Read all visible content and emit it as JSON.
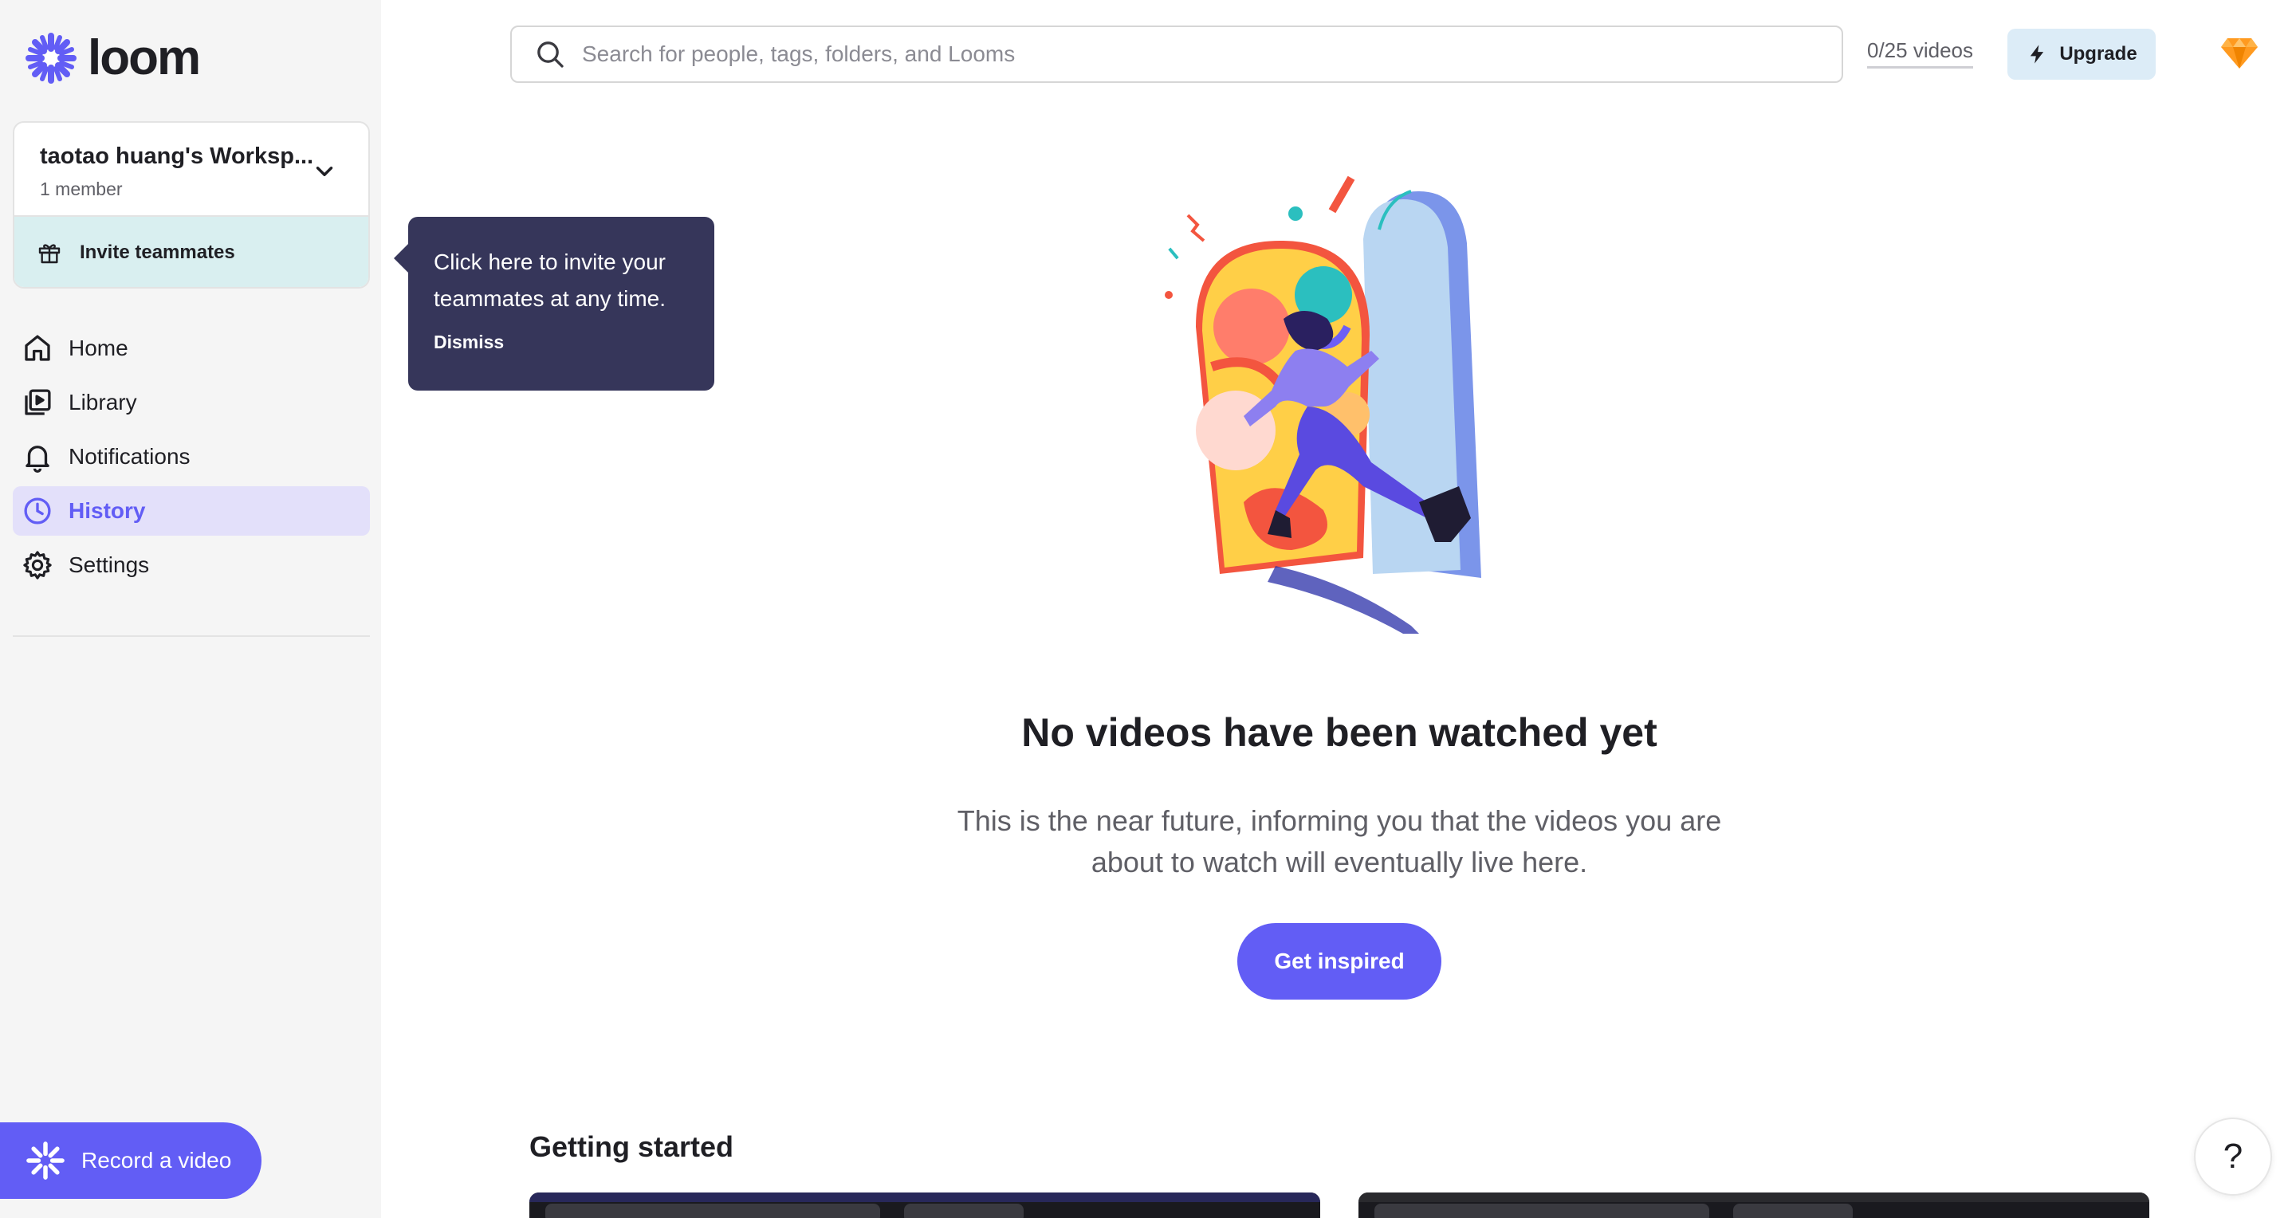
{
  "brand": {
    "name": "loom",
    "accent": "#625df5"
  },
  "workspace": {
    "name": "taotao huang's Worksp...",
    "members": "1 member",
    "invite_label": "Invite teammates"
  },
  "nav": {
    "items": [
      {
        "label": "Home",
        "icon": "home-icon"
      },
      {
        "label": "Library",
        "icon": "library-icon"
      },
      {
        "label": "Notifications",
        "icon": "bell-icon"
      },
      {
        "label": "History",
        "icon": "clock-icon",
        "active": true
      },
      {
        "label": "Settings",
        "icon": "gear-icon"
      }
    ]
  },
  "tooltip": {
    "text": "Click here to invite your teammates at any time.",
    "dismiss": "Dismiss"
  },
  "header": {
    "search_placeholder": "Search for people, tags, folders, and Looms",
    "video_count": "0/25 videos",
    "upgrade_label": "Upgrade"
  },
  "main": {
    "empty_title": "No videos have been watched yet",
    "empty_body": "This is the near future, informing you that the videos you are about to watch will eventually live here.",
    "cta_label": "Get inspired",
    "section_title": "Getting started"
  },
  "record": {
    "label": "Record a video"
  },
  "help": {
    "label": "?"
  }
}
